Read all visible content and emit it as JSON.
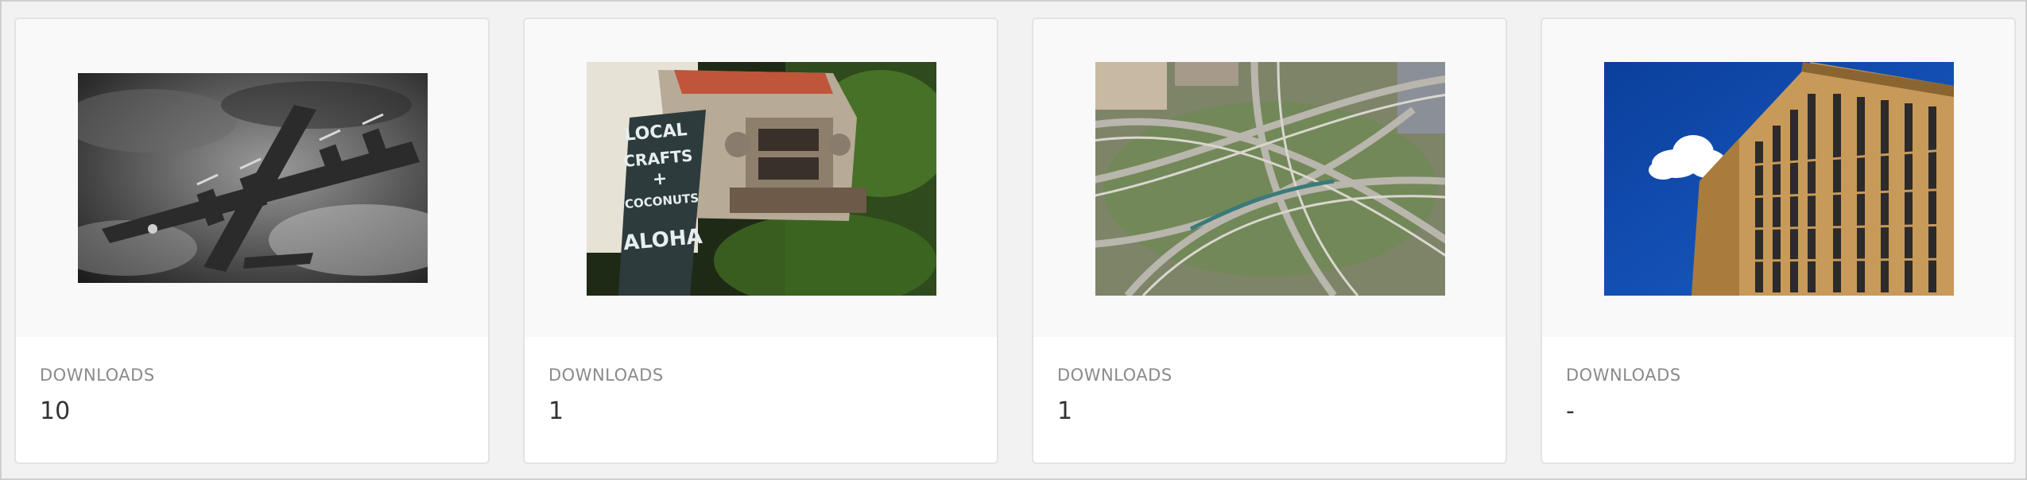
{
  "cards": [
    {
      "image": "vintage-bomber-plane-bw-photo",
      "label": "DOWNLOADS",
      "value": "10"
    },
    {
      "image": "old-truck-local-crafts-sign-photo",
      "label": "DOWNLOADS",
      "value": "1"
    },
    {
      "image": "highway-interchange-aerial-photo",
      "label": "DOWNLOADS",
      "value": "1"
    },
    {
      "image": "tan-building-blue-sky-photo",
      "label": "DOWNLOADS",
      "value": "-"
    }
  ],
  "sign_text": [
    "LOCAL",
    "CRAFTS",
    "+",
    "COCONUTS",
    "ALOHA"
  ],
  "colors": {
    "background": "#f2f2f2",
    "card": "#ffffff",
    "card_border": "#e3e3e3",
    "thumb_area": "#f9f9f9",
    "label": "#8a8a8a",
    "value": "#333333"
  }
}
